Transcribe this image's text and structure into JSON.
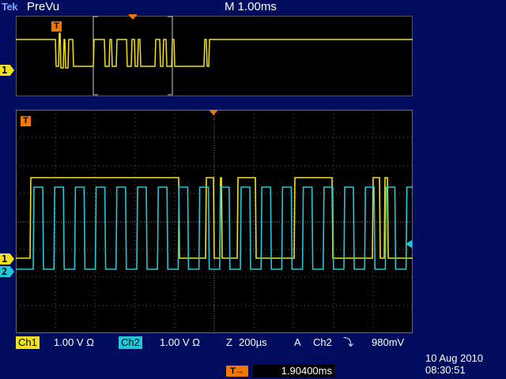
{
  "header": {
    "brand": "Tek",
    "mode": "PreVu",
    "timebase": "M 1.00ms"
  },
  "markers": {
    "trigger": "T",
    "ch1": "1",
    "ch2": "2"
  },
  "status_bar": {
    "ch1_label": "Ch1",
    "ch1_scale": "1.00 V Ω",
    "ch2_label": "Ch2",
    "ch2_scale": "1.00 V Ω",
    "zoom_label": "Z",
    "zoom_scale": "200µs",
    "trigger_mode": "A",
    "trigger_source": "Ch2",
    "trigger_slope": "⤵",
    "trigger_level": "980mV"
  },
  "trigger_position": {
    "icon": "T→",
    "value": "1.90400ms"
  },
  "timestamp": {
    "date": "10 Aug 2010",
    "time": "08:30:51"
  },
  "colors": {
    "ch1": "#f0e020",
    "ch2": "#20c8d8",
    "trigger": "#f07800",
    "background": "#000d5e",
    "grid": "#5a5a5a"
  }
}
